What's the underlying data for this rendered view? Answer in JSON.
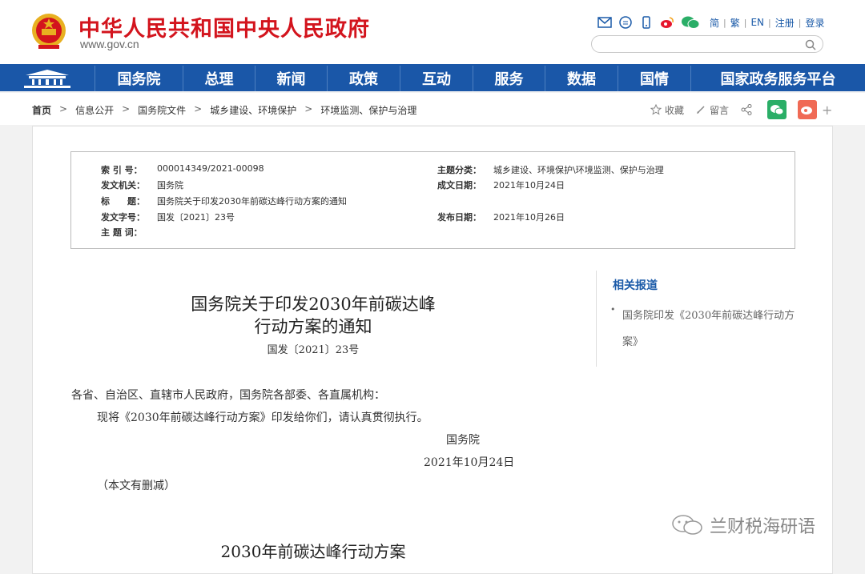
{
  "header": {
    "title": "中华人民共和国中央人民政府",
    "url": "www.gov.cn",
    "links": [
      "简",
      "繁",
      "EN",
      "注册",
      "登录"
    ],
    "search_placeholder": ""
  },
  "nav": {
    "items": [
      "国务院",
      "总理",
      "新闻",
      "政策",
      "互动",
      "服务",
      "数据",
      "国情",
      "国家政务服务平台"
    ]
  },
  "breadcrumb": [
    "首页",
    "信息公开",
    "国务院文件",
    "城乡建设、环境保护",
    "环境监测、保护与治理"
  ],
  "share": {
    "favorite": "收藏",
    "comment": "留言"
  },
  "meta": {
    "index_k": "索 引 号：",
    "index_v": "000014349/2021-00098",
    "topic_k": "主题分类：",
    "topic_v": "城乡建设、环境保护\\环境监测、保护与治理",
    "issuer_k": "发文机关：",
    "issuer_v": "国务院",
    "created_k": "成文日期：",
    "created_v": "2021年10月24日",
    "title_k": "标　　题：",
    "title_v": "国务院关于印发2030年前碳达峰行动方案的通知",
    "docno_k": "发文字号：",
    "docno_v": "国发〔2021〕23号",
    "pub_k": "发布日期：",
    "pub_v": "2021年10月26日",
    "kw_k": "主 题 词：",
    "kw_v": ""
  },
  "doc": {
    "title_line1": "国务院关于印发2030年前碳达峰",
    "title_line2": "行动方案的通知",
    "number": "国发〔2021〕23号",
    "salutation": "各省、自治区、直辖市人民政府，国务院各部委、各直属机构：",
    "body": "现将《2030年前碳达峰行动方案》印发给你们，请认真贯彻执行。",
    "signer": "国务院",
    "date": "2021年10月24日",
    "note": "（本文有删减）",
    "section_title": "2030年前碳达峰行动方案"
  },
  "side": {
    "title": "相关报道",
    "link": "国务院印发《2030年前碳达峰行动方案》"
  },
  "watermark": "兰财税海研语",
  "colors": {
    "brand_red": "#d3141d",
    "nav_blue": "#1a57a8",
    "link_blue": "#1a5aa8"
  }
}
